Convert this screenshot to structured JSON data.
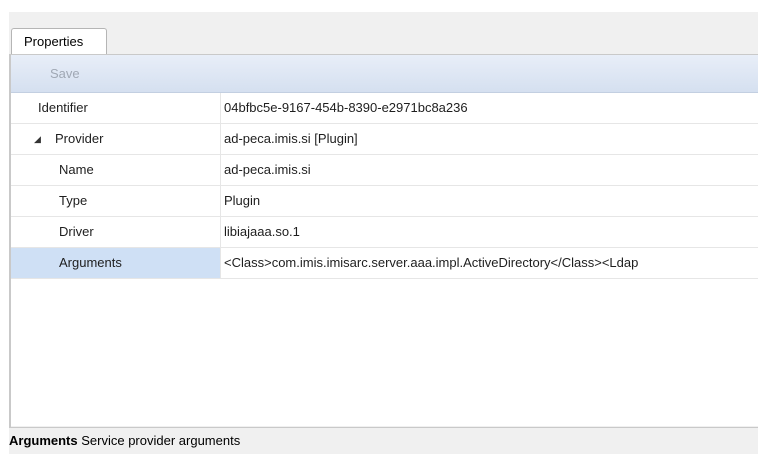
{
  "tabs": {
    "properties_label": "Properties"
  },
  "toolbar": {
    "save_label": "Save"
  },
  "grid": {
    "rows": [
      {
        "name": "Identifier",
        "value": "04bfbc5e-9167-454b-8390-e2971bc8a236"
      },
      {
        "name": "Provider",
        "value": "ad-peca.imis.si [Plugin]",
        "expander": "◢"
      },
      {
        "name": "Name",
        "value": "ad-peca.imis.si"
      },
      {
        "name": "Type",
        "value": "Plugin"
      },
      {
        "name": "Driver",
        "value": "libiajaaa.so.1"
      },
      {
        "name": "Arguments",
        "value": "<Class>com.imis.imisarc.server.aaa.impl.ActiveDirectory</Class><Ldap"
      }
    ]
  },
  "description": {
    "title": "Arguments",
    "text": " Service provider arguments"
  },
  "colors": {
    "selected_row": "#cfe0f5",
    "toolbar_top": "#e8eef8",
    "toolbar_bottom": "#d5e0f0"
  }
}
